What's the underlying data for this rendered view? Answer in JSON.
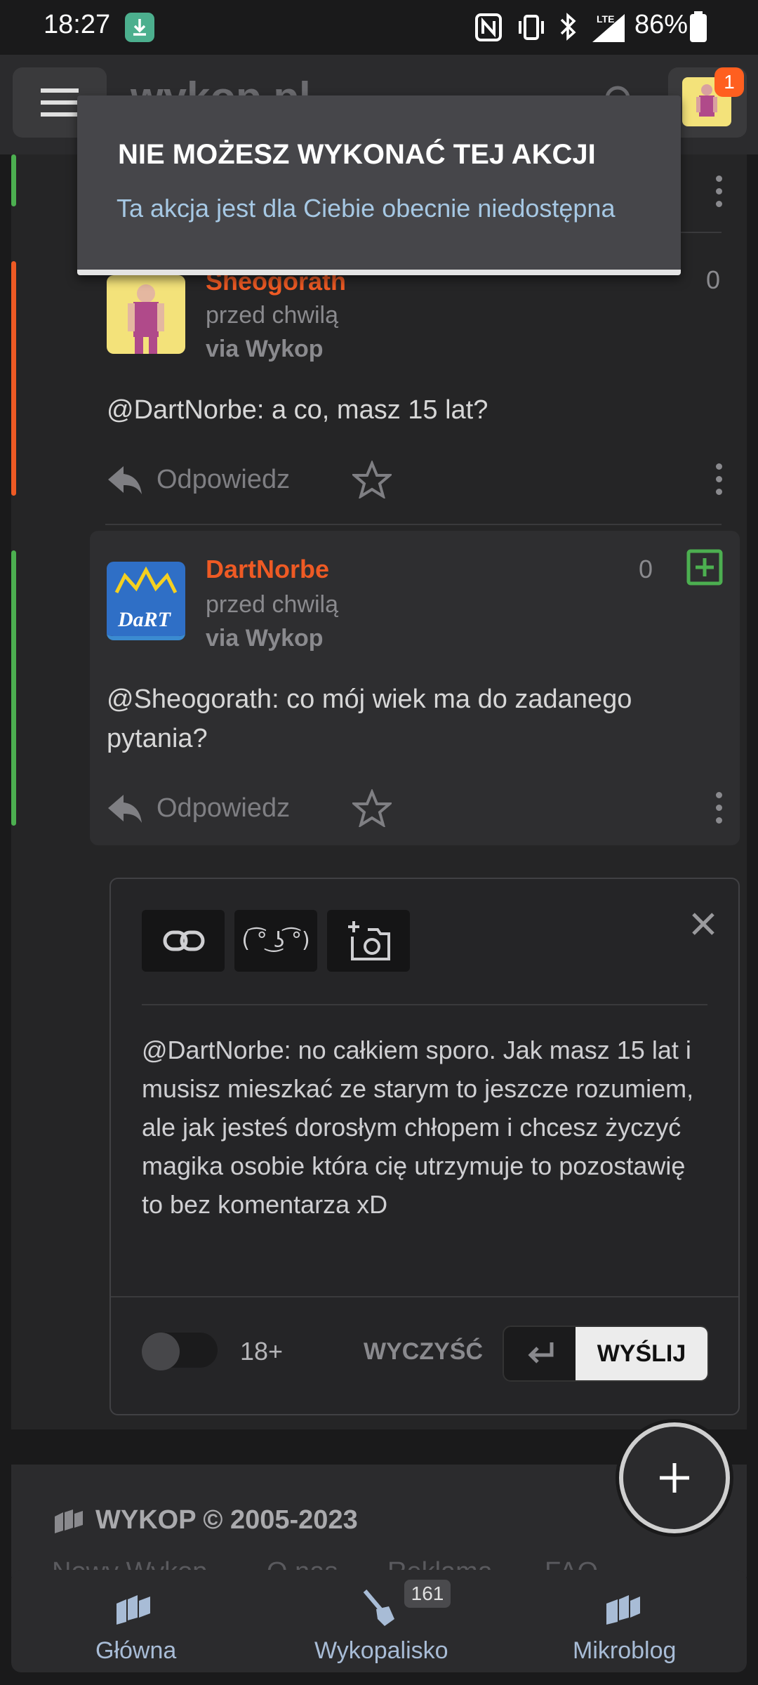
{
  "status_bar": {
    "time": "18:27",
    "battery": "86%"
  },
  "header": {
    "logo": "wykop.pl",
    "notification_count": "1"
  },
  "toast": {
    "title": "NIE MOŻESZ WYKONAĆ TEJ AKCJI",
    "message": "Ta akcja jest dla Ciebie obecnie niedostępna"
  },
  "comments": [
    {
      "author": "Sheogorath",
      "time": "przed chwilą",
      "via": "via Wykop",
      "score": "0",
      "text": "@DartNorbe: a co, masz 15 lat?",
      "reply_label": "Odpowiedz",
      "bar_color": "#ee5a24"
    },
    {
      "author": "DartNorbe",
      "time": "przed chwilą",
      "via": "via Wykop",
      "score": "0",
      "text": "@Sheogorath: co mój wiek ma do zadanego pytania?",
      "reply_label": "Odpowiedz",
      "bar_color": "#4caf50"
    }
  ],
  "editor": {
    "lenny_label": "( ͡° ͜ʖ ͡°)",
    "text": "@DartNorbe: no całkiem sporo. Jak masz 15 lat i musisz mieszkać ze starym to jeszcze rozumiem, ale jak jesteś dorosłym chłopem i chcesz życzyć magika osobie która cię utrzymuje to pozostawię to bez komentarza xD",
    "adult_label": "18+",
    "clear_label": "WYCZYŚĆ",
    "send_label": "WYŚLIJ",
    "adult_enabled": false
  },
  "footer": {
    "copyright": "WYKOP © 2005-2023",
    "links": [
      "Nowy Wykop",
      "O nas",
      "Reklama",
      "FAQ"
    ]
  },
  "bottom_nav": {
    "items": [
      {
        "label": "Główna"
      },
      {
        "label": "Wykopalisko",
        "badge": "161"
      },
      {
        "label": "Mikroblog"
      }
    ]
  },
  "colors": {
    "accent": "#ee5a24",
    "positive": "#4caf50",
    "link": "#a6c8e4"
  }
}
